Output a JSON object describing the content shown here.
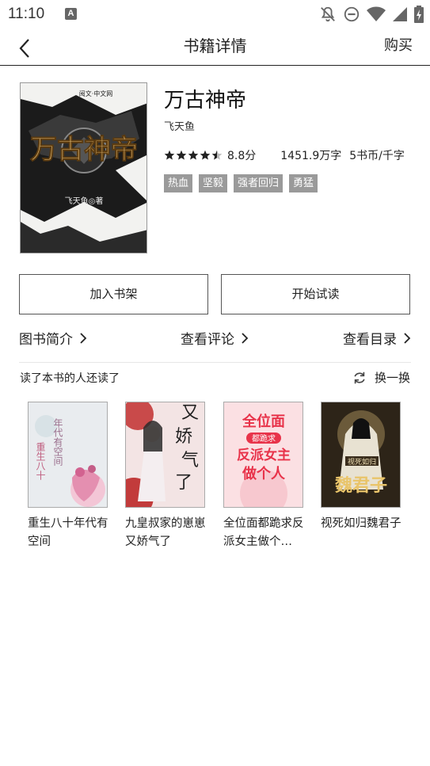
{
  "status_bar": {
    "time": "11:10",
    "notification_icon_letter": "A",
    "icons": [
      "bell-off-icon",
      "do-not-disturb-icon",
      "wifi-icon",
      "signal-icon",
      "battery-charging-icon"
    ]
  },
  "nav": {
    "back_icon": "chevron-left-icon",
    "title": "书籍详情",
    "buy_label": "购买"
  },
  "book": {
    "title": "万古神帝",
    "author": "飞天鱼",
    "rating_stars": 4.5,
    "rating_max": 5,
    "rating_text": "8.8分",
    "word_count": "1451.9万字",
    "price": "5书币/千字",
    "tags": [
      "热血",
      "坚毅",
      "强者回归",
      "勇猛"
    ],
    "cover": {
      "title_art": "万古神帝",
      "author_line": "飞天鱼◎著",
      "publisher_mark": "阅文·中文网"
    }
  },
  "actions": {
    "add_shelf_label": "加入书架",
    "start_read_label": "开始试读"
  },
  "links": {
    "intro_label": "图书简介",
    "comments_label": "查看评论",
    "catalog_label": "查看目录"
  },
  "recommend": {
    "header": "读了本书的人还读了",
    "refresh_label": "换一换",
    "items": [
      {
        "name": "重生八十年代有空间",
        "cover_text": "重生八十年代有空间"
      },
      {
        "name": "九皇叔家的崽崽又娇气了",
        "cover_text": "又娇气了"
      },
      {
        "name": "全位面都跪求反派女主做个…",
        "cover_text": "全位面都跪求反派女主做个人"
      },
      {
        "name": "视死如归魏君子",
        "cover_text": "视死如归魏君子"
      }
    ]
  },
  "colors": {
    "tag_bg": "#9a9a9a",
    "text": "#222222",
    "divider": "#e6e6e6"
  }
}
